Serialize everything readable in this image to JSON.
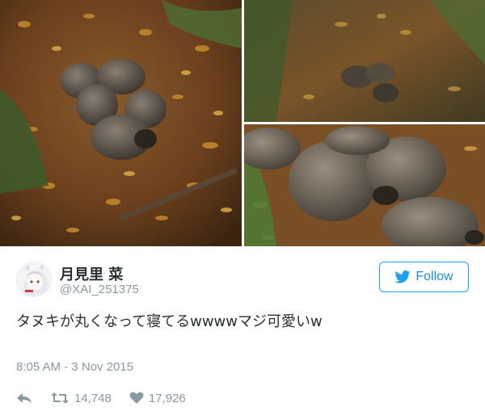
{
  "tweet": {
    "author": {
      "display_name": "月見里 菜",
      "handle": "@XAI_251375",
      "avatar_icon": "anime-avatar-icon"
    },
    "follow_button": {
      "label": "Follow",
      "icon": "twitter-bird-icon",
      "color": "#1da1f2"
    },
    "text": "タヌキが丸くなって寝てるwwwwマジ可愛いw",
    "timestamp": "8:05 AM - 3 Nov 2015",
    "actions": {
      "reply_icon": "reply-icon",
      "retweet_icon": "retweet-icon",
      "retweet_count": "14,748",
      "like_icon": "heart-icon",
      "like_count": "17,926"
    },
    "photos": [
      {
        "subject": "raccoon dogs sleeping curled up on autumn leaves"
      },
      {
        "subject": "raccoon dogs curled up in shade, distant view"
      },
      {
        "subject": "raccoon dogs curled up, close-up view"
      }
    ]
  }
}
